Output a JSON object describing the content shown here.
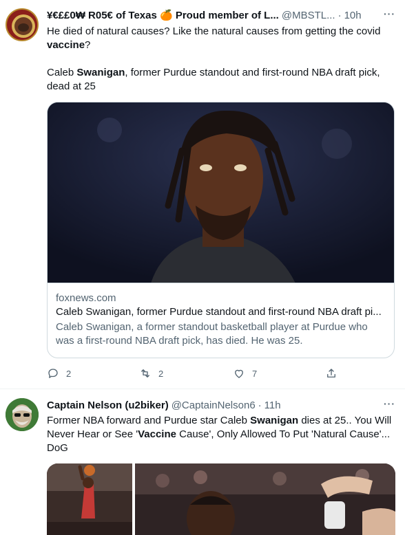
{
  "tweets": [
    {
      "display_name": "¥€££0₩ R05€ of Texas 🍊 Proud member of L...",
      "handle": "@MBSTL...",
      "dot": "·",
      "time": "10h",
      "more": "···",
      "text_line1": "He died of natural causes? Like the natural causes from getting the covid",
      "text_line2_bold": "vaccine",
      "text_line2_rest": "?",
      "headline_pre": "Caleb ",
      "headline_bold": "Swanigan",
      "headline_post": ", former Purdue standout and first-round NBA draft pick, dead at 25",
      "card": {
        "domain": "foxnews.com",
        "title": "Caleb Swanigan, former Purdue standout and first-round NBA draft pi...",
        "description": "Caleb Swanigan, a former standout basketball player at Purdue who was a first-round NBA draft pick, has died. He was 25."
      },
      "actions": {
        "replies": "2",
        "retweets": "2",
        "likes": "7"
      }
    },
    {
      "display_name": "Captain Nelson (u2biker)",
      "handle": "@CaptainNelson6",
      "dot": "·",
      "time": "11h",
      "more": "···",
      "seg1": "Former NBA forward and Purdue star Caleb ",
      "seg2_bold": "Swanigan",
      "seg3": " dies at 25.. You Will Never Hear or See '",
      "seg4_bold": "Vaccine",
      "seg5": " Cause', Only Allowed To Put 'Natural Cause'... DoG"
    }
  ],
  "icons": {
    "reply": "reply-icon",
    "retweet": "retweet-icon",
    "like": "heart-icon",
    "share": "share-icon"
  },
  "colors": {
    "text": "#0f1419",
    "muted": "#536471",
    "border": "#cfd9de"
  }
}
